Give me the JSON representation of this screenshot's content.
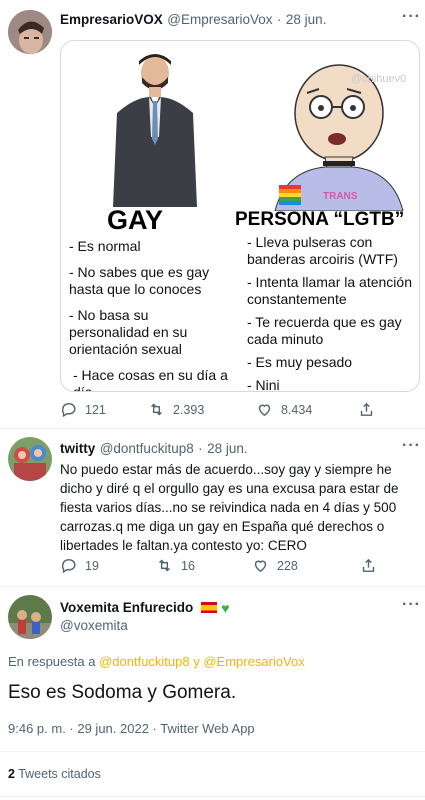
{
  "tweet1": {
    "name": "EmpresarioVOX",
    "handle": "@EmpresarioVox",
    "date": "28 jun.",
    "more": "···",
    "meme": {
      "watermark": "@chihuev0",
      "shirt_text": "TRANS",
      "left_title": "GAY",
      "right_title": "PERSONA “LGTB”",
      "left_items": [
        "- Es normal",
        "- No sabes que es gay hasta que lo conoces",
        "- No basa su personalidad en su orientación sexual",
        "- Hace cosas en su día a día"
      ],
      "right_items": [
        "- Lleva pulseras con banderas arcoiris (WTF)",
        "- Intenta llamar la atención constantemente",
        "- Te recuerda que es gay cada minuto",
        "- Es muy pesado",
        "- Nini"
      ]
    },
    "replies": "121",
    "retweets": "2.393",
    "likes": "8.434"
  },
  "tweet2": {
    "name": "twitty",
    "handle": "@dontfuckitup8",
    "date": "28 jun.",
    "more": "···",
    "text": "No puedo estar más de acuerdo...soy gay y siempre he dicho y diré q el orgullo gay es una excusa para estar de fiesta varios días...no se reivindica nada en 4 días y 500 carrozas.q me diga un gay en España qué derechos o libertades le faltan.ya contesto yo: CERO",
    "replies": "19",
    "retweets": "16",
    "likes": "228"
  },
  "tweet3": {
    "name": "Voxemita Enfurecido",
    "handle": "@voxemita",
    "more": "···",
    "in_reply_prefix": "En respuesta a",
    "in_reply_user1": "@dontfuckitup8",
    "in_reply_and": "y",
    "in_reply_user2": "@EmpresarioVox",
    "text": "Eso es Sodoma y Gomera.",
    "meta": "9:46 p. m. · 29 jun. 2022 · Twitter Web App",
    "quotes_count": "2",
    "quotes_label": "Tweets citados"
  },
  "colors": {
    "secondary": "#536471",
    "primary": "#0f1419",
    "highlight": "#f2b600",
    "divider": "#eff3f4"
  }
}
